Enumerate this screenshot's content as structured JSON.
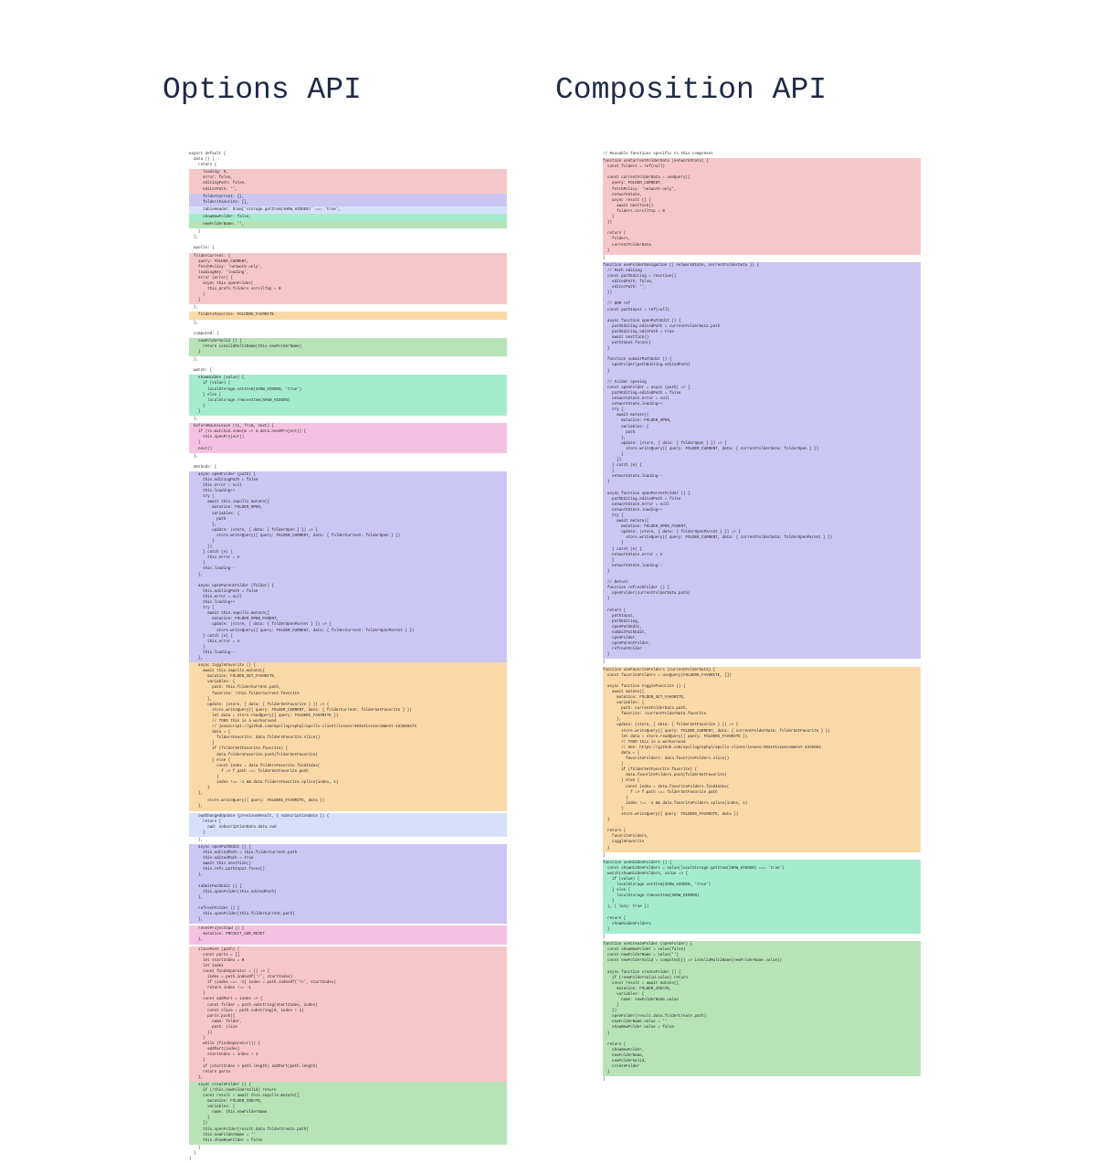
{
  "headings": {
    "left": "Options API",
    "right": "Composition API"
  },
  "colors": {
    "red": "#f6c7c9",
    "purple": "#cbc6f2",
    "mint": "#a5eccf",
    "orange": "#f9d9a8",
    "pink": "#f4c2e0",
    "green": "#b7e3b7",
    "blue": "#d7e0fa",
    "white": "#ffffff",
    "heading": "#1f2a44",
    "background": "#ffffff"
  },
  "columns": {
    "left": [
      {
        "color": "white",
        "lines": 3,
        "text": "export default {\n  data () {\n    return {"
      },
      {
        "color": "red",
        "lines": 4,
        "text": "      loading: 0,\n      error: false,\n      editingPath: false,\n      editorPath: '',"
      },
      {
        "color": "purple",
        "lines": 2,
        "text": "      folderCurrent: {},\n      foldersFavorite: [],"
      },
      {
        "color": "blue",
        "lines": 1,
        "text": "      tableHeader: Enum['storage.getItem(SHOW_HIDDEN)' === 'true',"
      },
      {
        "color": "mint",
        "lines": 1,
        "text": "      showNewFolder: false,"
      },
      {
        "color": "green",
        "lines": 1,
        "text": "      newFolderName: '',"
      },
      {
        "color": "white",
        "lines": 4,
        "text": "    }\n  },\n\n  apollo: {"
      },
      {
        "color": "red",
        "lines": 9,
        "text": "  folderCurrent: {\n    query: FOLDER_CURRENT,\n    fetchPolicy: 'network-only',\n    loadingKey: 'loading',\n    error (error) {\n      async this.openFolder(\n        this.prefs.folders.scrollTop = 0\n      )\n    }"
      },
      {
        "color": "white",
        "lines": 1,
        "text": "  },"
      },
      {
        "color": "orange",
        "lines": 1,
        "text": "    foldersFavorite: FOLDERS_FAVORITE"
      },
      {
        "color": "white",
        "lines": 3,
        "text": "  },\n\n  computed: {"
      },
      {
        "color": "green",
        "lines": 3,
        "text": "    newFolderValid () {\n      return isValidMultiName(this.newFolderName)\n    }"
      },
      {
        "color": "white",
        "lines": 3,
        "text": "  },\n\n  watch: {"
      },
      {
        "color": "mint",
        "lines": 7,
        "text": "    showHidden (value) {\n      if (value) {\n        localStorage.setItem(SHOW_HIDDEN, 'true')\n      } else {\n        localStorage.removeItem(SHOW_HIDDEN)\n      }\n    }"
      },
      {
        "color": "white",
        "lines": 2,
        "text": "  },\n"
      },
      {
        "color": "pink",
        "lines": 5,
        "text": "  beforeRouteLeave (to, from, next) {\n    if (to.matched.some(m => m.meta.needProject)) {\n      this.openProject()\n    }\n    next()"
      },
      {
        "color": "white",
        "lines": 3,
        "text": "  },\n\n  methods: {"
      },
      {
        "color": "purple",
        "lines": 33,
        "text": "    async openFolder (path) {\n      this.editingPath = false\n      this.error = null\n      this.loading++\n      try {\n        await this.sapollo.mutate({\n          mutation: FOLDER_OPEN,\n          variables: {\n            path\n          },\n          update: (store, { data: { folderOpen } }) => {\n            store.writeQuery({ query: FOLDER_CURRENT, data: { folderCurrent: folderOpen } })\n          }\n        })\n      } catch (e) {\n        this.error = e\n      }\n      this.loading--\n    },\n\n    async openParentFolder (folder) {\n      this.editingPath = false\n      this.error = null\n      this.loading++\n      try {\n        await this.sapollo.mutate({\n          mutation: FOLDER_OPEN_PARENT,\n          update: (store, { data: { folderOpenParent } }) => {\n            store.writeQuery({ query: FOLDER_CURRENT, data: { folderCurrent: folderOpenParent } })\n      } catch (e) {\n        this.error = e\n      }\n      this.loading--\n    },"
      },
      {
        "color": "orange",
        "lines": 24,
        "text": "    async toggleFavorite () {\n      await this.sapollo.mutate({\n        mutation: FOLDER_SET_FAVORITE,\n        variables: {\n          path: this.folderCurrent.path,\n          favorite: !this.folderCurrent.favorite\n        },\n        update: (store, { data: { folderSetFavorite } }) => {\n          store.writeQuery({ query: FOLDER_CURRENT, data: { folderCurrent: folderSetFavorite } })\n          let data = store.readQuery({ query: FOLDERS_FAVORITE })\n          // TODO this is a workaround\n          // javascript://github.com/apollographql/apollo-client/issues/4031#issuecomment-433668473\n          data = {\n            foldersFavorite: data.foldersFavorite.slice()\n          }\n          if (folderSetFavorite.favorite) {\n            data.foldersFavorite.push(folderSetFavorite)\n          } else {\n            const index = data.foldersFavorite.findIndex(\n              f => f.path === folderSetFavorite.path\n            )\n            index !== -1 && data.foldersFavorite.splice(index, 1)\n        }\n    },"
      },
      {
        "color": "orange",
        "lines": 2,
        "text": "        store.writeQuery({ query: FOLDERS_FAVORITE, data })\n    },"
      },
      {
        "color": "white",
        "lines": 1,
        "text": ""
      },
      {
        "color": "blue",
        "lines": 4,
        "text": "    cwdChangedUpdate (previousResult, { subscriptionData }) {\n      return {\n        cwd: subscriptionData.data.cwd\n      }"
      },
      {
        "color": "white",
        "lines": 1,
        "text": "    },"
      },
      {
        "color": "purple",
        "lines": 14,
        "text": "    async openPathEdit () {\n      this.editedPath = this.folderCurrent.path\n      this.editedPath = true\n      await this.nextTick()\n      this.refs.pathInput.focus()\n    },\n\n    submitPathEdit () {\n      this.openFolder(this.editedPath)\n    },\n\n    refreshFolder () {\n      this.openFolder(this.folderCurrent.path)\n    },"
      },
      {
        "color": "white",
        "lines": 1,
        "text": ""
      },
      {
        "color": "pink",
        "lines": 3,
        "text": "    resetProjectCwd () {\n      mutation: PROJECT_CWD_RESET\n    },"
      },
      {
        "color": "white",
        "lines": 1,
        "text": ""
      },
      {
        "color": "red",
        "lines": 25,
        "text": "    slicePath (path) {\n      const parts = []\n      let startIndex = 0\n      let index\n      const findSeparator = () => {\n        index = path.indexOf('/', startIndex)\n        if (index === -1) index = path.indexOf('\\\\', startIndex)\n        return index !== -1\n      }\n      const addPart = index => {\n        const folder = path.substring(startIndex, index)\n        const slice = path.substring(0, index + 1)\n        parts.push({\n          name: folder,\n          path: slice\n        })\n      }\n      while (findSeparator()) {\n        addPart(index)\n        startIndex = index + 1\n      }\n      if (startIndex < path.length) addPart(path.length)\n      return parts\n    },\n"
      },
      {
        "color": "green",
        "lines": 11,
        "text": "    async createFolder () {\n      if (!this.newFolderValid) return\n      const result = await this.sapollo.mutate({\n        mutation: FOLDER_CREATE,\n        variables: {\n          name: this.newFolderName\n        }\n      })\n      this.openFolder(result.data.folderCreate.path)\n      this.newFolderName = ''\n      this.showNewFolder = false"
      },
      {
        "color": "white",
        "lines": 3,
        "text": "    }\n  }\n}"
      }
    ],
    "right": [
      {
        "color": "white",
        "lines": 1,
        "text": "// Reusable functions specific to this component"
      },
      {
        "color": "red",
        "lines": 17,
        "text": "function useCurrentFolderData (networkState) {\n  const folders = ref(null)\n\n  const currentFolderData = useQuery({\n    query: FOLDER_CURRENT,\n    fetchPolicy: 'network-only',\n    networkState,\n    async result () {\n      await nextTick()\n      folders.scrollTop = 0\n    }\n  })\n\n  return {\n    folders,\n    currentFolderData\n  }"
      },
      {
        "color": "white",
        "lines": 1,
        "text": "}"
      },
      {
        "color": "purple",
        "lines": 60,
        "text": "function useFolderNavigation ({ networkState, currentFolderData }) {\n  // Path editing\n  const pathEditing = reactive({\n    editedPath: false,\n    editorPath: '',\n  })\n\n  // DOM ref\n  const pathInput = ref(null)\n\n  async function openPathEdit () {\n    pathEditing.editedPath = currentFolderData.path\n    pathEditing.editPath = true\n    await nextTick()\n    pathInput.focus()\n  }\n\n  function submitPathEdit () {\n    openFolder(pathEditing.editedPath)\n  }\n\n  // Folder opening\n  const openFolder = async (path) => {\n    pathEditing.editedPath = false\n    networkState.error = null\n    networkState.loading++\n    try {\n      await mutate({\n        mutation: FOLDER_OPEN,\n        variables: {\n          path\n        },\n        update: (store, { data: { folderOpen } }) => {\n          store.writeQuery({ query: FOLDER_CURRENT, data: { currentFolderData: folderOpen } })\n        }\n      })\n    } catch (e) {\n    }\n    networkState.loading--\n  }\n\n  async function openParentFolder () {\n    pathEditing.editedPath = false\n    networkState.error = null\n    networkState.loading++\n    try {\n      await mutate({\n        mutation: FOLDER_OPEN_PARENT,\n        update: (store, { data: { folderOpenParent } }) => {\n          store.writeQuery({ query: FOLDER_CURRENT, data: { currentFolderData: folderOpenParent } })\n        }\n    } catch (e) {\n    networkState.error = e\n    }\n    networkState.loading--\n  }\n\n  // Return\n  function refreshFolder () {\n    openFolder(currentFolderData.path)\n  }\n\n  return {\n    pathInput,\n    pathEditing,\n    openPathEdit,\n    submitPathEdit,\n    openFolder,\n    openParentFolder,\n    refreshFolder\n  }"
      },
      {
        "color": "white",
        "lines": 1,
        "text": "}"
      },
      {
        "color": "orange",
        "lines": 31,
        "text": "function useFavoriteFolders (currentFolderData) {\n  const favoriteFolders = useQuery(FOLDERS_FAVORITE, [])\n\n  async function toggleFavorite () {\n    await mutate({\n      mutation: FOLDER_SET_FAVORITE,\n      variables: {\n        path: currentFolderData.path,\n        favorite: !currentFolderData.favorite\n      },\n      update: (store, { data: { folderSetFavorite } }) => {\n        store.writeQuery({ query: FOLDER_CURRENT, data: { currentFolderData: folderSetFavorite } })\n        let data = store.readQuery({ query: FOLDERS_FAVORITE })\n        // TODO this is a workaround\n        // See: https://github.com/apollographql/apollo-client/issues/4031#issuecomment-4336684\n        data = {\n          favoriteFolders: data.favoriteFolders.slice()\n        }\n        if (folderSetFavorite.favorite) {\n          data.favoriteFolders.push(folderSetFavorite)\n        } else {\n          const index = data.favoriteFolders.findIndex(\n            f => f.path === folderSetFavorite.path\n          )\n          index !== -1 && data.favoriteFolders.splice(index, 1)\n        }\n        store.writeQuery({ query: FOLDERS_FAVORITE, data })\n  }\n\n  return {\n    favoriteFolders,\n    toggleFavorite\n  }"
      },
      {
        "color": "white",
        "lines": 1,
        "text": "}"
      },
      {
        "color": "mint",
        "lines": 13,
        "text": "function useHiddenFolders () {\n  const showHiddenFolders = value(localStorage.getItem(SHOW_HIDDEN) === 'true')\n  watch(showHiddenFolders, value => {\n    if (value) {\n      localStorage.setItem(SHOW_HIDDEN, 'true')\n    } else {\n      localStorage.removeItem(SHOW_HIDDEN)\n    }\n  }, { lazy: true })\n\n  return {\n    showHiddenFolders\n  }"
      },
      {
        "color": "white",
        "lines": 1,
        "text": "}"
      },
      {
        "color": "green",
        "lines": 24,
        "text": "function useCreateFolder (openFolder) {\n  const showNewFolder = value(false)\n  const newFolderName = value('')\n  const newFolderValid = computed(() => isValidMultiName(newFolderName.value))\n\n  async function createFolder () {\n    if (!newFolderValid.value) return\n    const result = await mutate({\n      mutation: FOLDER_CREATE,\n      variables: {\n        name: newFolderName.value\n      }\n    })\n    openFolder(result.data.folderCreate.path)\n    newFolderName.value = ''\n    showNewFolder.value = false\n  }\n\n  return {\n    showNewFolder,\n    newFolderName,\n    newFolderValid,\n    createFolder\n  }"
      },
      {
        "color": "white",
        "lines": 1,
        "text": "}"
      }
    ]
  }
}
